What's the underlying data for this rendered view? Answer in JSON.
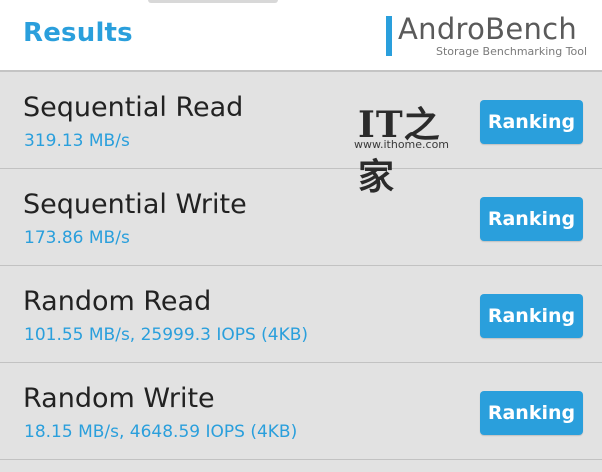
{
  "header": {
    "title": "Results",
    "logo_name": "AndroBench",
    "logo_tagline": "Storage Benchmarking Tool"
  },
  "watermark": {
    "mark": "IT之家",
    "url": "www.ithome.com"
  },
  "results": [
    {
      "name": "Sequential Read",
      "value": "319.13 MB/s",
      "button": "Ranking"
    },
    {
      "name": "Sequential Write",
      "value": "173.86 MB/s",
      "button": "Ranking"
    },
    {
      "name": "Random Read",
      "value": "101.55 MB/s, 25999.3 IOPS (4KB)",
      "button": "Ranking"
    },
    {
      "name": "Random Write",
      "value": "18.15 MB/s, 4648.59 IOPS (4KB)",
      "button": "Ranking"
    }
  ],
  "colors": {
    "accent": "#2a9fdc",
    "row_background": "#e2e2e2",
    "header_background": "#ffffff",
    "title_text": "#222222"
  }
}
